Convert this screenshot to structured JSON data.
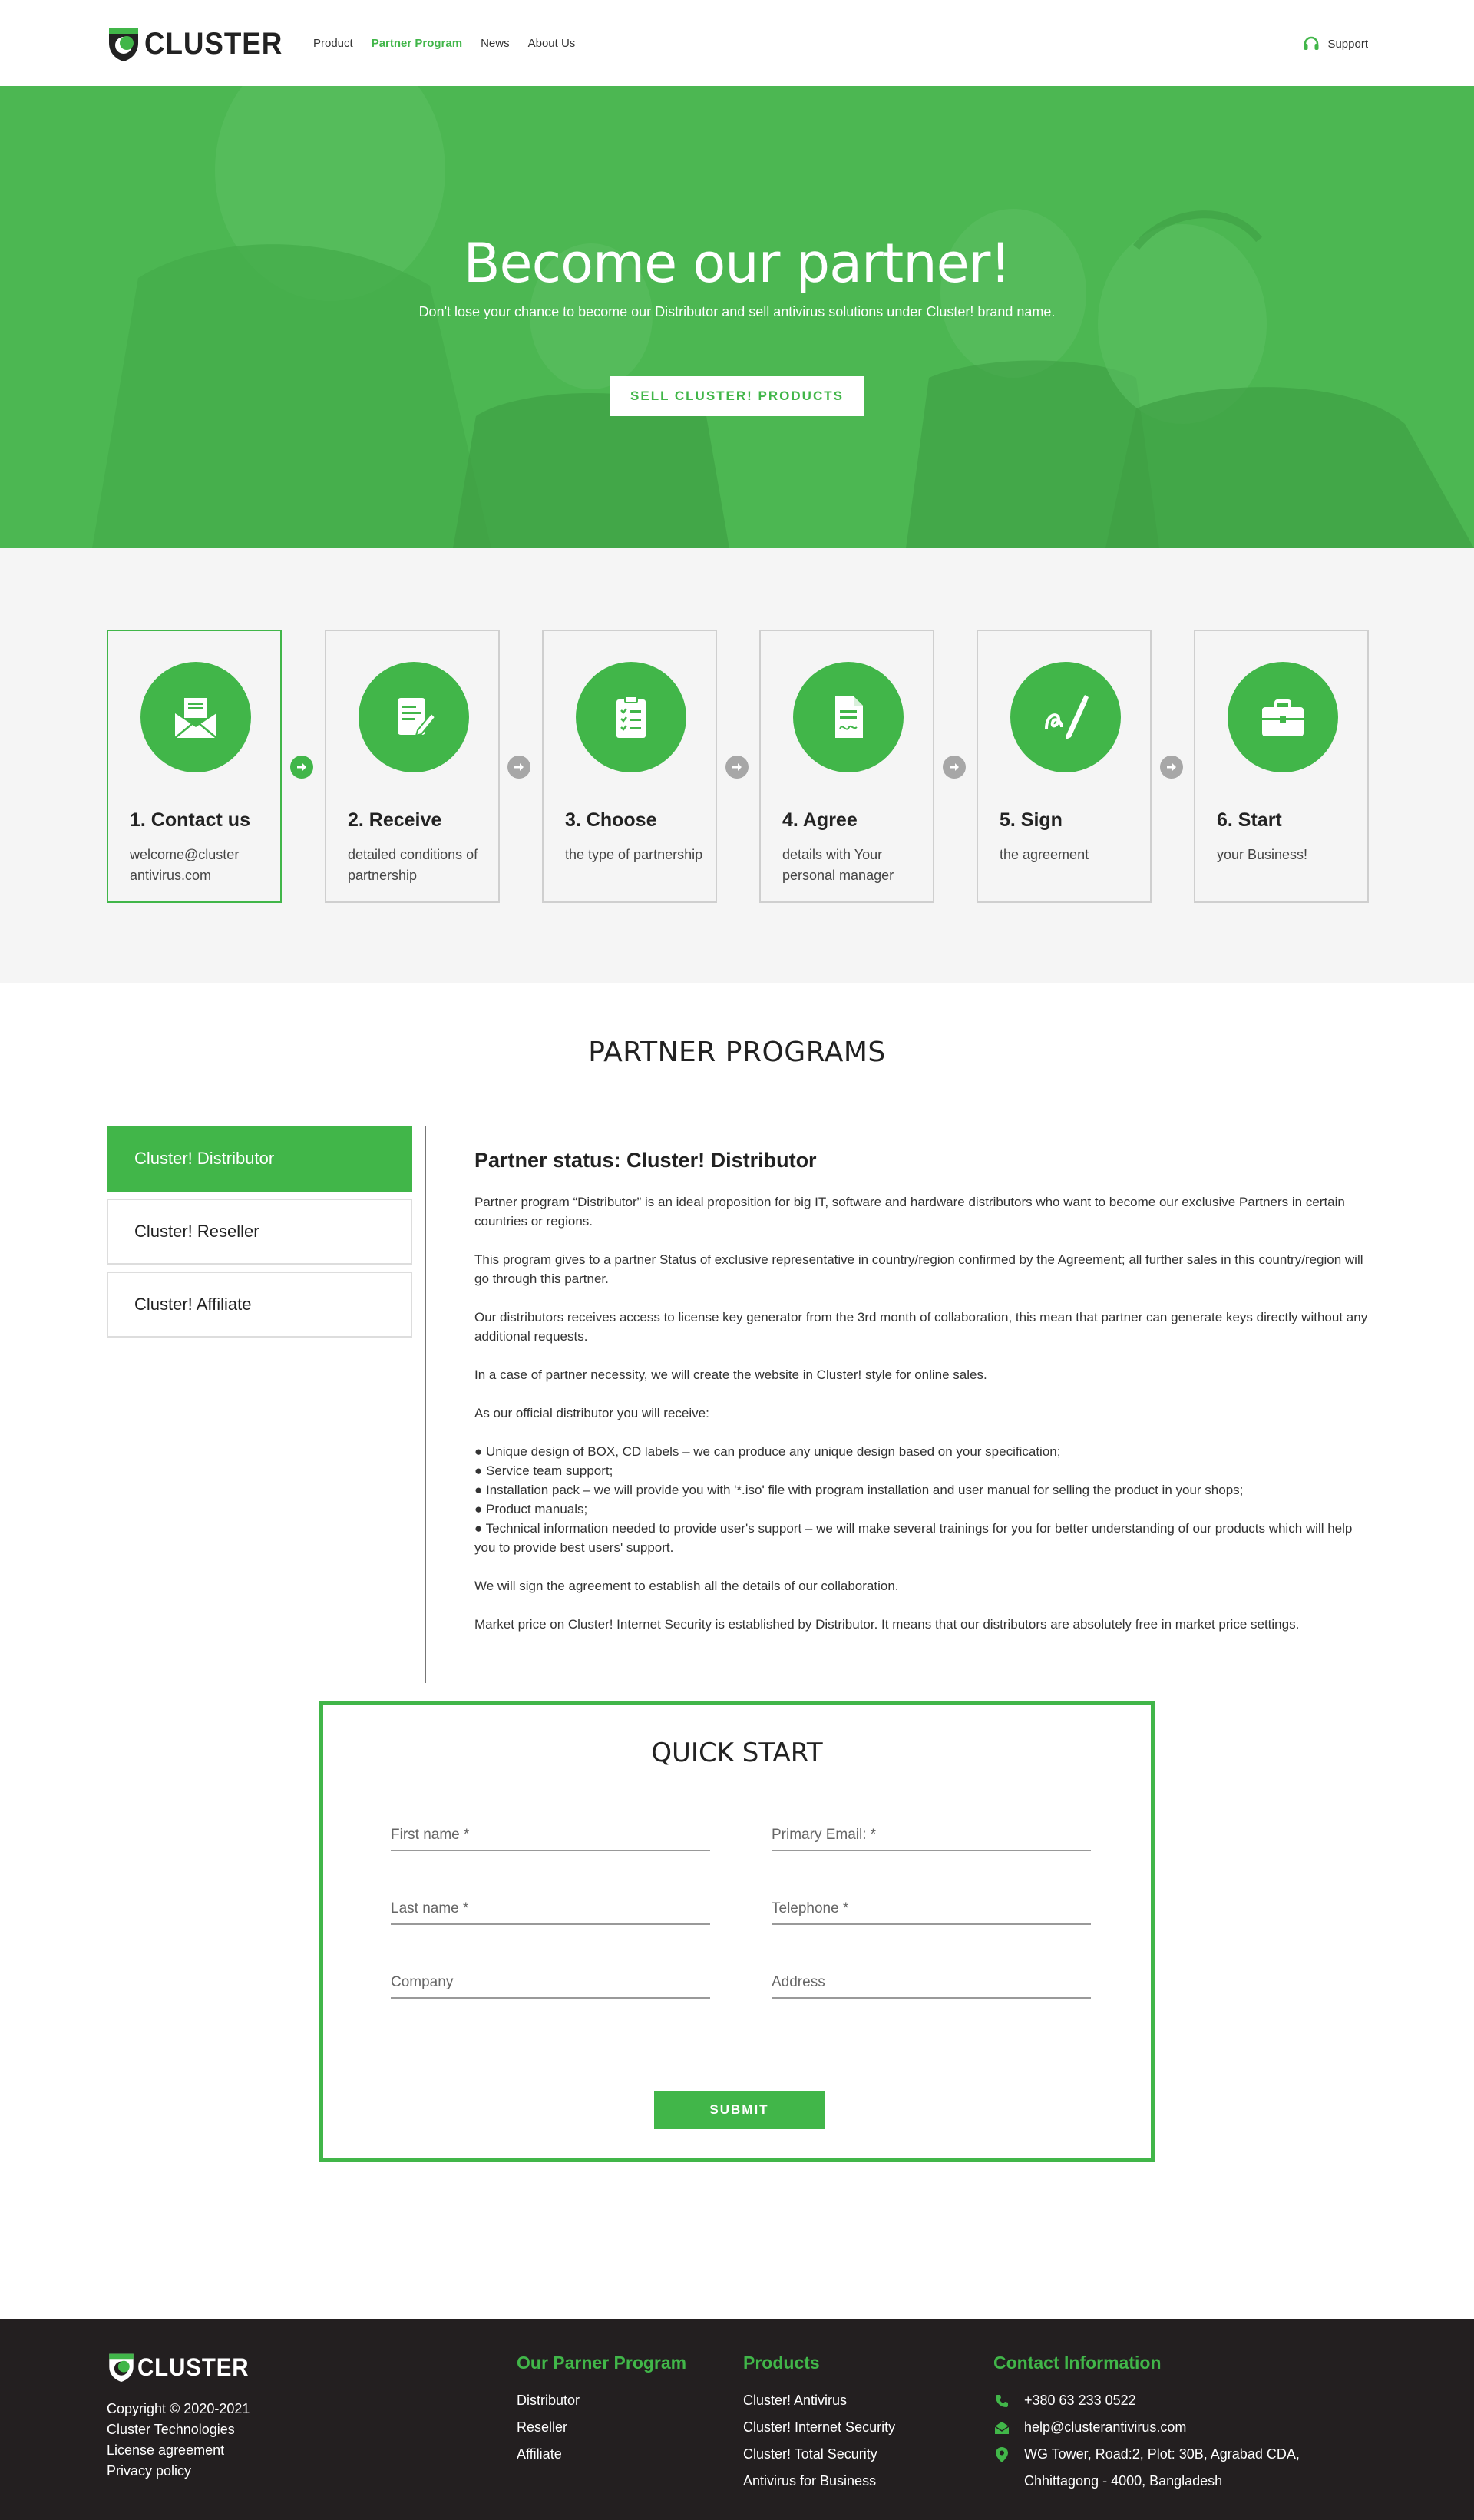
{
  "brand": {
    "name": "CLUSTER",
    "accent": "#41b649"
  },
  "nav": {
    "items": [
      "Product",
      "Partner Program",
      "News",
      "About Us"
    ],
    "active": "Partner Program",
    "support": "Support"
  },
  "hero": {
    "title": "Become our partner!",
    "subtitle": "Don't lose your chance to become our Distributor and sell antivirus solutions under Cluster! brand name.",
    "cta": "SELL CLUSTER! PRODUCTS"
  },
  "steps": [
    {
      "title": "1. Contact us",
      "desc": "welcome@cluster antivirus.com",
      "icon": "envelope-icon"
    },
    {
      "title": "2. Receive",
      "desc": "detailed conditions of partnership",
      "icon": "document-pen-icon"
    },
    {
      "title": "3. Choose",
      "desc": "the type of partnership",
      "icon": "clipboard-checklist-icon"
    },
    {
      "title": "4. Agree",
      "desc": "details with Your personal manager",
      "icon": "signed-document-icon"
    },
    {
      "title": "5. Sign",
      "desc": "the agreement",
      "icon": "signature-pen-icon"
    },
    {
      "title": "6. Start",
      "desc": "your Business!",
      "icon": "briefcase-icon"
    }
  ],
  "programs": {
    "heading": "PARTNER PROGRAMS",
    "tabs": [
      "Cluster! Distributor",
      "Cluster! Reseller",
      "Cluster! Affiliate"
    ],
    "content": {
      "title": "Partner status: Cluster! Distributor",
      "p1": "Partner program “Distributor” is an ideal proposition for big IT, software and hardware distributors who want to become our exclusive Partners in certain countries or regions.",
      "p2": "This program gives to a partner Status of exclusive representative in country/region confirmed by the Agreement; all further sales in this country/region will go through this partner.",
      "p3": "Our distributors receives access to license key generator from the 3rd month of collaboration, this mean that partner can generate keys directly without any additional requests.",
      "p4": "In a case of partner necessity, we will create the website in Cluster! style for online sales.",
      "p5": "As our official distributor you will receive:",
      "bullets": [
        "● Unique design of BOX, CD labels – we can produce any unique design based on your specification;",
        "● Service team support;",
        "● Installation pack – we will provide you with '*.iso' file with program installation and user manual for selling the product in your shops;",
        "● Product manuals;",
        "● Technical information needed to provide user's support – we will make several trainings for you for better understanding of our products which will help you to provide best users' support."
      ],
      "p6": "We will sign the agreement to establish all the details of our collaboration.",
      "p7": "Market price on Cluster! Internet Security is established by Distributor. It means that our distributors are absolutely free in market price settings."
    }
  },
  "quick_start": {
    "heading": "QUICK START",
    "first_name": "First name *",
    "email": "Primary Email: *",
    "last_name": "Last name *",
    "telephone": "Telephone *",
    "company": "Company",
    "address": "Address",
    "submit": "SUBMIT"
  },
  "footer": {
    "copyright": "Copyright © 2020-2021",
    "company": "Cluster Technologies",
    "license": "License agreement",
    "privacy": "Privacy policy",
    "partner_heading": "Our Parner Program",
    "partner_links": [
      "Distributor",
      "Reseller",
      "Affiliate"
    ],
    "products_heading": "Products",
    "product_links": [
      "Cluster! Antivirus",
      "Cluster! Internet Security",
      "Cluster! Total Security",
      "Antivirus for Business"
    ],
    "contact_heading": "Contact Information",
    "phone": "+380 63 233 0522",
    "email": "help@clusterantivirus.com",
    "address_line1": "WG Tower, Road:2, Plot: 30B, Agrabad CDA,",
    "address_line2": "Chhittagong - 4000, Bangladesh"
  }
}
